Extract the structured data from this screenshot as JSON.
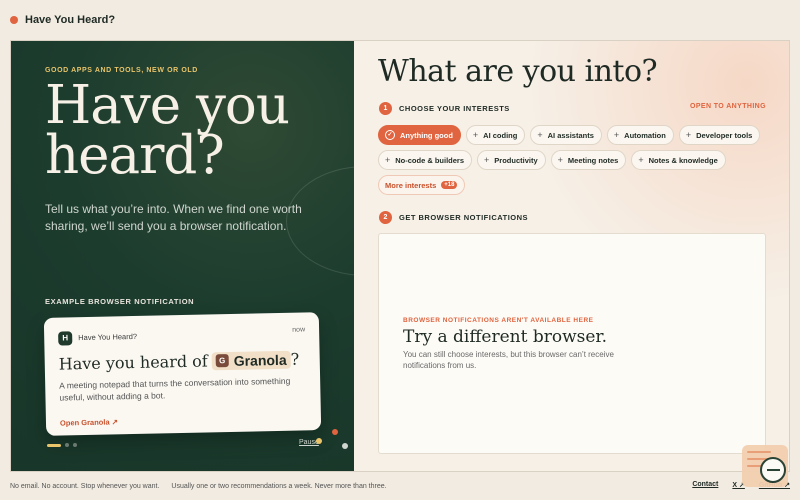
{
  "window": {
    "title": "Have You Heard?"
  },
  "hero": {
    "eyebrow": "GOOD APPS AND TOOLS, NEW OR OLD",
    "title_line1": "Have you",
    "title_line2": "heard?",
    "lead": "Tell us what you’re into. When we find one worth sharing, we’ll send you a browser notification.",
    "example_label": "EXAMPLE BROWSER NOTIFICATION"
  },
  "notification": {
    "logo_letter": "H",
    "app_name": "Have You Heard?",
    "time": "now",
    "headline_prefix": "Have you heard of",
    "product_initial": "G",
    "product_name": "Granola",
    "headline_suffix": "?",
    "body": "A meeting notepad that turns the conversation into something useful, without adding a bot.",
    "link": "Open Granola ↗"
  },
  "carousel": {
    "pause_label": "Pause"
  },
  "interests": {
    "question": "What are you into?",
    "step1_num": "1",
    "step1_label": "CHOOSE YOUR INTERESTS",
    "open_to_anything": "OPEN TO ANYTHING",
    "chips": [
      {
        "label": "Anything good",
        "selected": true
      },
      {
        "label": "AI coding",
        "selected": false
      },
      {
        "label": "AI assistants",
        "selected": false
      },
      {
        "label": "Automation",
        "selected": false
      },
      {
        "label": "Developer tools",
        "selected": false
      },
      {
        "label": "No-code & builders",
        "selected": false
      },
      {
        "label": "Productivity",
        "selected": false
      },
      {
        "label": "Meeting notes",
        "selected": false
      },
      {
        "label": "Notes & knowledge",
        "selected": false
      }
    ],
    "more_label": "More interests",
    "more_count": "+18",
    "step2_num": "2",
    "step2_label": "GET BROWSER NOTIFICATIONS"
  },
  "browser_panel": {
    "warning": "BROWSER NOTIFICATIONS AREN'T AVAILABLE HERE",
    "heading": "Try a different browser.",
    "body": "You can still choose interests, but this browser can’t receive notifications from us."
  },
  "footer": {
    "note1": "No email. No account. Stop whenever you want.",
    "note2": "Usually one or two recommendations a week. Never more than three.",
    "contact": "Contact",
    "x": "X ↗",
    "github": "GitHub ↗"
  },
  "colors": {
    "accent": "#e0643f",
    "forest": "#1c3c2e",
    "gold": "#e9c46a",
    "cream": "#f6f0e7"
  },
  "icons": {
    "check": "check-icon",
    "plus": "plus-icon",
    "external": "external-link-icon"
  }
}
